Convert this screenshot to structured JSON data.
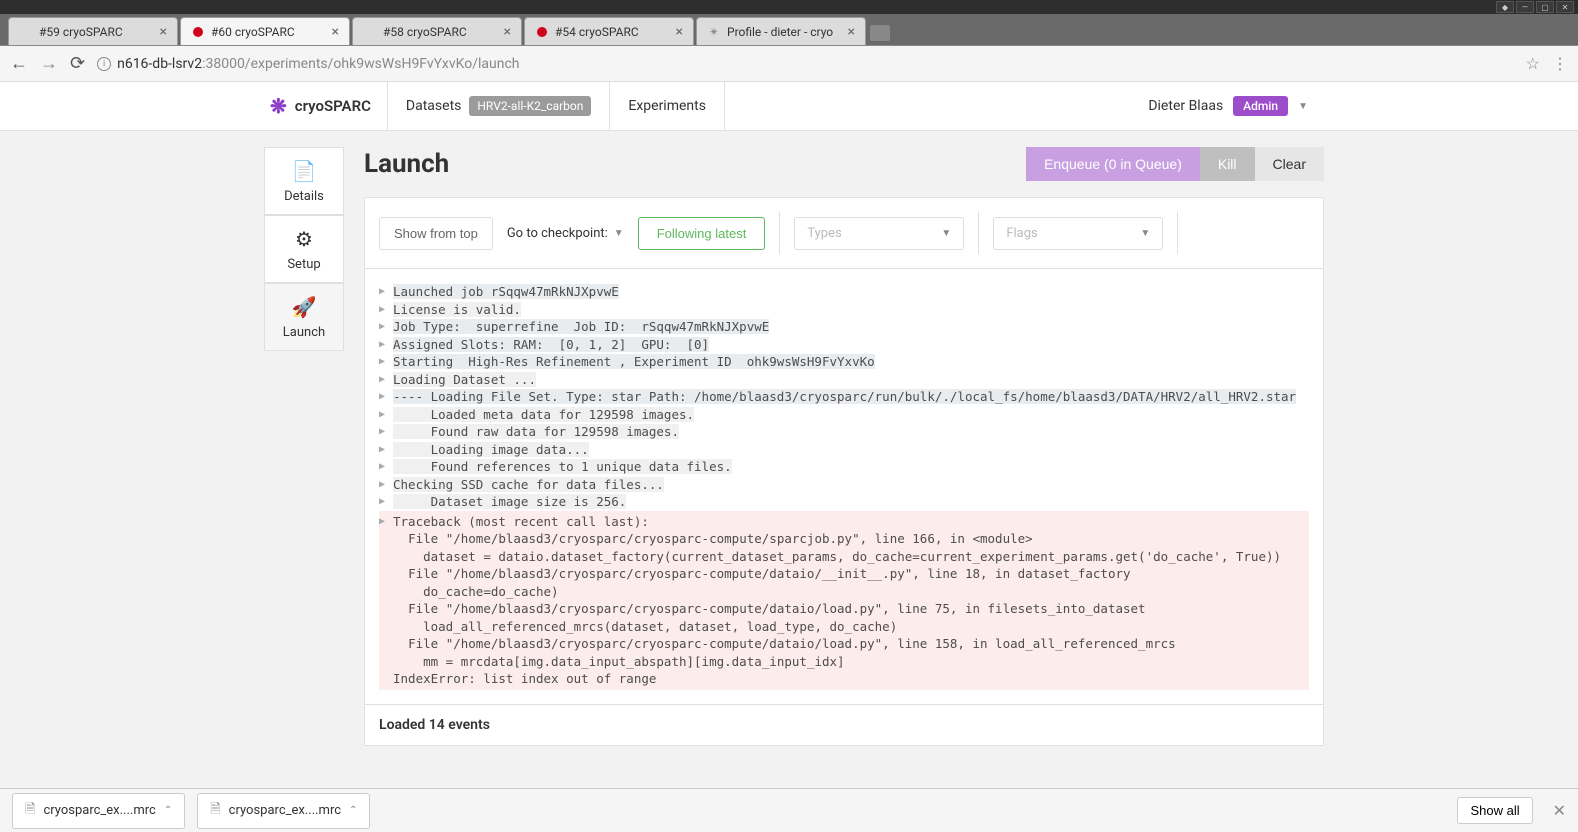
{
  "window": {
    "tabs": [
      {
        "title": "#59 cryoSPARC",
        "dot": null,
        "favtext": ""
      },
      {
        "title": "#60 cryoSPARC",
        "dot": "#d0021b",
        "favtext": ""
      },
      {
        "title": "#58 cryoSPARC",
        "dot": null,
        "favtext": ""
      },
      {
        "title": "#54 cryoSPARC",
        "dot": "#d0021b",
        "favtext": ""
      },
      {
        "title": "Profile - dieter - cryo",
        "dot": null,
        "favtext": "✴"
      }
    ],
    "active_tab": 1,
    "url_host": "n616-db-lsrv2",
    "url_path": ":38000/experiments/ohk9wsWsH9FvYxvKo/launch"
  },
  "nav": {
    "brand": "cryoSPARC",
    "datasets": "Datasets",
    "dataset_tag": "HRV2-all-K2_carbon",
    "experiments": "Experiments",
    "user": "Dieter Blaas",
    "admin": "Admin"
  },
  "sidebar": {
    "details": "Details",
    "setup": "Setup",
    "launch": "Launch"
  },
  "page": {
    "title": "Launch",
    "enqueue": "Enqueue (0 in Queue)",
    "kill": "Kill",
    "clear": "Clear"
  },
  "toolbar": {
    "show_top": "Show from top",
    "goto": "Go to checkpoint:",
    "following": "Following latest",
    "types": "Types",
    "flags": "Flags"
  },
  "logs": [
    {
      "caret": true,
      "cls": "hl-blue",
      "text": "Launched job rSqqw47mRkNJXpvwE"
    },
    {
      "caret": true,
      "cls": "hl-gray",
      "text": "License is valid."
    },
    {
      "caret": true,
      "cls": "hl-blue",
      "text": "Job Type:  superrefine  Job ID:  rSqqw47mRkNJXpvwE"
    },
    {
      "caret": true,
      "cls": "hl-blue",
      "text": "Assigned Slots: RAM:  [0, 1, 2]  GPU:  [0]"
    },
    {
      "caret": true,
      "cls": "hl-blue",
      "text": "Starting  High-Res Refinement , Experiment ID  ohk9wsWsH9FvYxvKo"
    },
    {
      "caret": true,
      "cls": "hl-gray",
      "text": "Loading Dataset ..."
    },
    {
      "caret": true,
      "cls": "hl-blue",
      "text": "---- Loading File Set. Type: star Path: /home/blaasd3/cryosparc/run/bulk/./local_fs/home/blaasd3/DATA/HRV2/all_HRV2.star"
    },
    {
      "caret": true,
      "cls": "hl-gray",
      "text": "     Loaded meta data for 129598 images."
    },
    {
      "caret": true,
      "cls": "hl-gray",
      "text": "     Found raw data for 129598 images."
    },
    {
      "caret": true,
      "cls": "hl-gray",
      "text": "     Loading image data..."
    },
    {
      "caret": true,
      "cls": "hl-gray",
      "text": "     Found references to 1 unique data files."
    },
    {
      "caret": true,
      "cls": "hl-gray",
      "text": "Checking SSD cache for data files..."
    },
    {
      "caret": true,
      "cls": "hl-gray",
      "text": "     Dataset image size is 256."
    },
    {
      "caret": true,
      "cls": "traceback",
      "text": "Traceback (most recent call last):\n  File \"/home/blaasd3/cryosparc/cryosparc-compute/sparcjob.py\", line 166, in <module>\n    dataset = dataio.dataset_factory(current_dataset_params, do_cache=current_experiment_params.get('do_cache', True))\n  File \"/home/blaasd3/cryosparc/cryosparc-compute/dataio/__init__.py\", line 18, in dataset_factory\n    do_cache=do_cache)\n  File \"/home/blaasd3/cryosparc/cryosparc-compute/dataio/load.py\", line 75, in filesets_into_dataset\n    load_all_referenced_mrcs(dataset, dataset, load_type, do_cache)\n  File \"/home/blaasd3/cryosparc/cryosparc-compute/dataio/load.py\", line 158, in load_all_referenced_mrcs\n    mm = mrcdata[img.data_input_abspath][img.data_input_idx]\nIndexError: list index out of range"
    }
  ],
  "footer": {
    "text": "Loaded 14 events"
  },
  "downloads": {
    "items": [
      "cryosparc_ex....mrc",
      "cryosparc_ex....mrc"
    ],
    "showall": "Show all"
  }
}
